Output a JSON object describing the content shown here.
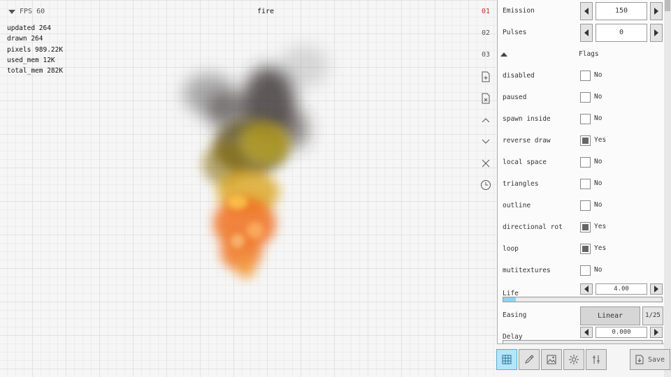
{
  "canvas": {
    "fps": "FPS 60",
    "title": "fire",
    "stats": [
      "updated 264",
      "drawn 264",
      "pixels 989.22K",
      "used_mem 12K",
      "total_mem 282K"
    ]
  },
  "side_tools": {
    "layers": [
      "01",
      "02",
      "03"
    ],
    "icons": [
      "new-layer-icon",
      "delete-layer-icon",
      "move-up-icon",
      "move-down-icon",
      "close-icon",
      "clock-icon"
    ]
  },
  "panel": {
    "emission": {
      "label": "Emission",
      "value": "150"
    },
    "pulses": {
      "label": "Pulses",
      "value": "0"
    },
    "flags_header": "Flags",
    "flags": [
      {
        "label": "disabled",
        "state": "No",
        "checked": false
      },
      {
        "label": "paused",
        "state": "No",
        "checked": false
      },
      {
        "label": "spawn inside",
        "state": "No",
        "checked": false
      },
      {
        "label": "reverse draw",
        "state": "Yes",
        "checked": true
      },
      {
        "label": "local space",
        "state": "No",
        "checked": false
      },
      {
        "label": "triangles",
        "state": "No",
        "checked": false
      },
      {
        "label": "outline",
        "state": "No",
        "checked": false
      },
      {
        "label": "directional rot",
        "state": "Yes",
        "checked": true
      },
      {
        "label": "loop",
        "state": "Yes",
        "checked": true
      },
      {
        "label": "mutitextures",
        "state": "No",
        "checked": false
      }
    ],
    "life": {
      "label": "Life",
      "value": "4.00",
      "progress": 0.08
    },
    "easing": {
      "label": "Easing",
      "value": "Linear",
      "index": "1/25"
    },
    "delay": {
      "label": "Delay",
      "value": "0.000",
      "progress": 0.0
    }
  },
  "bottom_bar": {
    "icons": [
      "grid-icon",
      "pipette-icon",
      "image-icon",
      "sparkle-icon",
      "wrench-icon"
    ],
    "save_label": "Save",
    "accent": "#8fd3f0"
  }
}
